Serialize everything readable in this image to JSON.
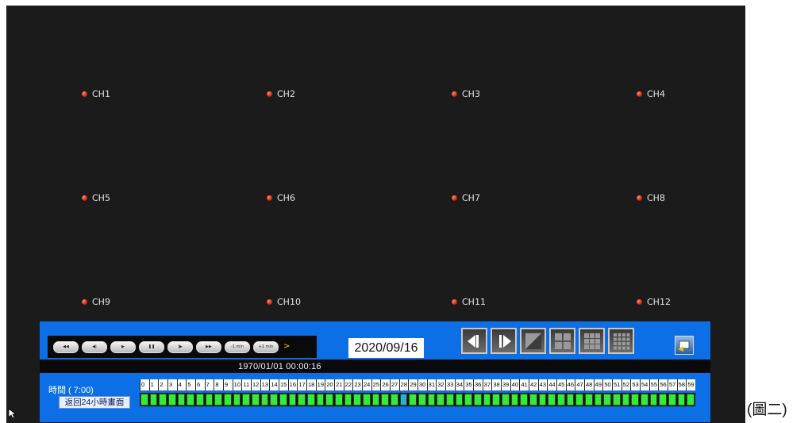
{
  "channels": [
    {
      "label": "CH1"
    },
    {
      "label": "CH2"
    },
    {
      "label": "CH3"
    },
    {
      "label": "CH4"
    },
    {
      "label": "CH5"
    },
    {
      "label": "CH6"
    },
    {
      "label": "CH7"
    },
    {
      "label": "CH8"
    },
    {
      "label": "CH9"
    },
    {
      "label": "CH10"
    },
    {
      "label": "CH11"
    },
    {
      "label": "CH12"
    }
  ],
  "playback": {
    "buttons": [
      {
        "name": "fast-rewind",
        "glyph": "◀◀"
      },
      {
        "name": "step-back",
        "glyph": "◀|"
      },
      {
        "name": "play",
        "glyph": "▶"
      },
      {
        "name": "pause",
        "glyph": "❚❚"
      },
      {
        "name": "step-forward",
        "glyph": "|▶"
      },
      {
        "name": "fast-forward",
        "glyph": "▶▶"
      },
      {
        "name": "minus-1min",
        "glyph": "-1 min"
      },
      {
        "name": "plus-1min",
        "glyph": "+1 min"
      }
    ],
    "more_label": ">"
  },
  "date": "2020/09/16",
  "timestamp": "1970/01/01   00:00:16",
  "time_label": "時間 ( 7:00)",
  "back_button": "返回24小時畫面",
  "selected_minute": 28,
  "caption": "(圖二)",
  "colors": {
    "panel": "#0d6fe6",
    "minute_bar": "#38e83a",
    "channel_dot": "#d81e00"
  }
}
